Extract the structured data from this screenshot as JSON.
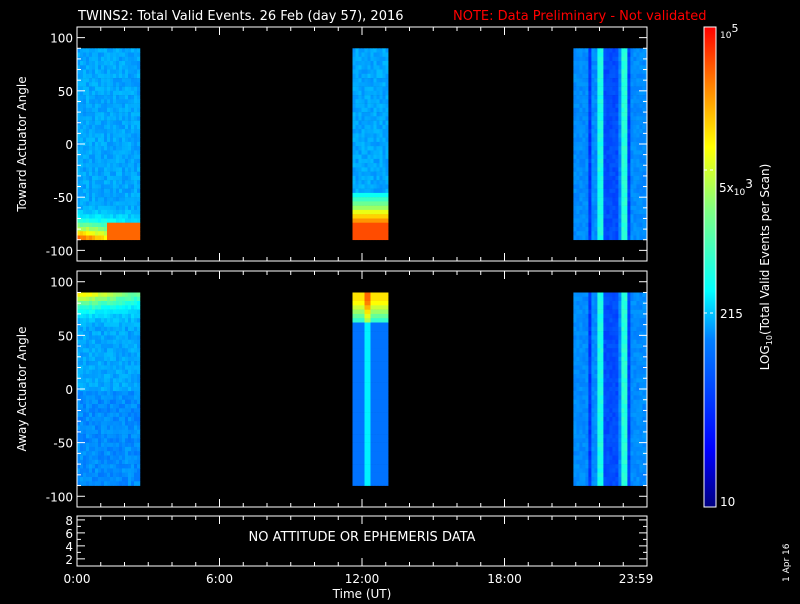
{
  "title": "TWINS2: Total Valid Events. 26 Feb (day  57), 2016",
  "note": "NOTE: Data Preliminary - Not validated",
  "colors": {
    "title": "#ffffff",
    "note": "#ff0000",
    "axes": "#ffffff",
    "background": "#000000"
  },
  "chart_data": [
    {
      "type": "heatmap",
      "panel": "toward",
      "ylabel": "Toward Actuator Angle",
      "ylim": [
        -110,
        110
      ],
      "yticks": [
        -100,
        -50,
        0,
        50,
        100
      ],
      "ytick_labels": [
        "-100",
        "-50",
        "0",
        "50",
        "100"
      ],
      "data_angle_range": [
        -90,
        90
      ],
      "xlim_hours": [
        0,
        24
      ],
      "data_blocks_hours": [
        [
          0,
          2.65
        ],
        [
          11.6,
          13.1
        ],
        [
          20.9,
          24
        ]
      ],
      "features": "Background ~100-200 events; enhanced flux (~10^4) at angles -90 to -70 in first and second blocks; vertical stripes in last block"
    },
    {
      "type": "heatmap",
      "panel": "away",
      "ylabel": "Away Actuator Angle",
      "ylim": [
        -110,
        110
      ],
      "yticks": [
        -100,
        -50,
        0,
        50,
        100
      ],
      "ytick_labels": [
        "-100",
        "-50",
        "0",
        "50",
        "100"
      ],
      "data_angle_range": [
        -90,
        90
      ],
      "xlim_hours": [
        0,
        24
      ],
      "data_blocks_hours": [
        [
          0,
          2.65
        ],
        [
          11.6,
          13.1
        ],
        [
          20.9,
          24
        ]
      ],
      "features": "Enhanced flux (~5x10^3) at angles 70 to 90 in first and second blocks; vertical stripes in last block"
    },
    {
      "type": "line",
      "panel": "ephemeris",
      "yticks": [
        2,
        4,
        6,
        8
      ],
      "ytick_labels": [
        "2",
        "4",
        "6",
        "8"
      ],
      "ylim": [
        0.9,
        8.6
      ],
      "message": "NO ATTITUDE OR EPHEMERIS DATA"
    }
  ],
  "xaxis": {
    "label": "Time (UT)",
    "tick_labels": [
      "0:00",
      "6:00",
      "12:00",
      "18:00",
      "23:59"
    ],
    "tick_hours": [
      0,
      6,
      12,
      18,
      24
    ]
  },
  "colorbar": {
    "label_prefix": "LOG",
    "label_sub": "10",
    "label_rest": "(Total Valid Events per Scan)",
    "log_range": [
      1,
      5
    ],
    "ticks": [
      {
        "value": 100000,
        "base": "10",
        "exp": "5",
        "mant": ""
      },
      {
        "value": 5000,
        "base": "10",
        "exp": "3",
        "mant": "5x"
      },
      {
        "value": 215,
        "base": "",
        "exp": "",
        "mant": "215"
      },
      {
        "value": 10,
        "base": "",
        "exp": "",
        "mant": "10"
      }
    ]
  },
  "date_stamp": "1 Apr 16"
}
